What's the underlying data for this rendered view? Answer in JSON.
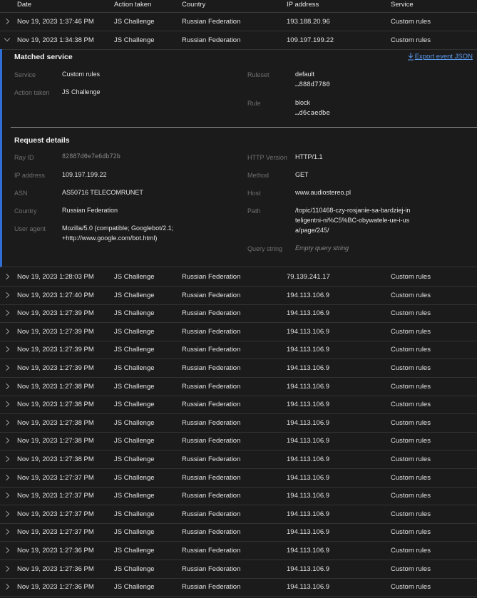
{
  "columns": [
    "Date",
    "Action taken",
    "Country",
    "IP address",
    "Service"
  ],
  "rows_top": [
    {
      "date": "Nov 19, 2023 1:37:46 PM",
      "action": "JS Challenge",
      "country": "Russian Federation",
      "ip": "193.188.20.96",
      "service": "Custom rules"
    },
    {
      "date": "Nov 19, 2023 1:34:38 PM",
      "action": "JS Challenge",
      "country": "Russian Federation",
      "ip": "109.197.199.22",
      "service": "Custom rules"
    }
  ],
  "expanded": {
    "matched_title": "Matched service",
    "export_label": "Export event JSON",
    "service_label": "Service",
    "service_value": "Custom rules",
    "action_label": "Action taken",
    "action_value": "JS Challenge",
    "ruleset_label": "Ruleset",
    "ruleset_name": "default",
    "ruleset_id": "…888d7780",
    "rule_label": "Rule",
    "rule_name": "block",
    "rule_id": "…d6caedbe",
    "request_title": "Request details",
    "rayid_label": "Ray ID",
    "rayid_value": "82887d0e7e6db72b",
    "ip_label": "IP address",
    "ip_value": "109.197.199.22",
    "asn_label": "ASN",
    "asn_value": "AS50716 TELECOMRUNET",
    "country_label": "Country",
    "country_value": "Russian Federation",
    "ua_label": "User agent",
    "ua_line1": "Mozilla/5.0 (compatible; Googlebot/2.1;",
    "ua_line2": "+http://www.google.com/bot.html)",
    "http_label": "HTTP Version",
    "http_value": "HTTP/1.1",
    "method_label": "Method",
    "method_value": "GET",
    "host_label": "Host",
    "host_value": "www.audiostereo.pl",
    "path_label": "Path",
    "path_line1": "/topic/110468-czy-rosjanie-sa-bardziej-in",
    "path_line2": "teligentni-ni%C5%BC-obywatele-ue-i-us",
    "path_line3": "a/page/245/",
    "query_label": "Query string",
    "query_value": "Empty query string"
  },
  "rows_bottom": [
    {
      "date": "Nov 19, 2023 1:28:03 PM",
      "action": "JS Challenge",
      "country": "Russian Federation",
      "ip": "79.139.241.17",
      "service": "Custom rules"
    },
    {
      "date": "Nov 19, 2023 1:27:40 PM",
      "action": "JS Challenge",
      "country": "Russian Federation",
      "ip": "194.113.106.9",
      "service": "Custom rules"
    },
    {
      "date": "Nov 19, 2023 1:27:39 PM",
      "action": "JS Challenge",
      "country": "Russian Federation",
      "ip": "194.113.106.9",
      "service": "Custom rules"
    },
    {
      "date": "Nov 19, 2023 1:27:39 PM",
      "action": "JS Challenge",
      "country": "Russian Federation",
      "ip": "194.113.106.9",
      "service": "Custom rules"
    },
    {
      "date": "Nov 19, 2023 1:27:39 PM",
      "action": "JS Challenge",
      "country": "Russian Federation",
      "ip": "194.113.106.9",
      "service": "Custom rules"
    },
    {
      "date": "Nov 19, 2023 1:27:39 PM",
      "action": "JS Challenge",
      "country": "Russian Federation",
      "ip": "194.113.106.9",
      "service": "Custom rules"
    },
    {
      "date": "Nov 19, 2023 1:27:38 PM",
      "action": "JS Challenge",
      "country": "Russian Federation",
      "ip": "194.113.106.9",
      "service": "Custom rules"
    },
    {
      "date": "Nov 19, 2023 1:27:38 PM",
      "action": "JS Challenge",
      "country": "Russian Federation",
      "ip": "194.113.106.9",
      "service": "Custom rules"
    },
    {
      "date": "Nov 19, 2023 1:27:38 PM",
      "action": "JS Challenge",
      "country": "Russian Federation",
      "ip": "194.113.106.9",
      "service": "Custom rules"
    },
    {
      "date": "Nov 19, 2023 1:27:38 PM",
      "action": "JS Challenge",
      "country": "Russian Federation",
      "ip": "194.113.106.9",
      "service": "Custom rules"
    },
    {
      "date": "Nov 19, 2023 1:27:38 PM",
      "action": "JS Challenge",
      "country": "Russian Federation",
      "ip": "194.113.106.9",
      "service": "Custom rules"
    },
    {
      "date": "Nov 19, 2023 1:27:37 PM",
      "action": "JS Challenge",
      "country": "Russian Federation",
      "ip": "194.113.106.9",
      "service": "Custom rules"
    },
    {
      "date": "Nov 19, 2023 1:27:37 PM",
      "action": "JS Challenge",
      "country": "Russian Federation",
      "ip": "194.113.106.9",
      "service": "Custom rules"
    },
    {
      "date": "Nov 19, 2023 1:27:37 PM",
      "action": "JS Challenge",
      "country": "Russian Federation",
      "ip": "194.113.106.9",
      "service": "Custom rules"
    },
    {
      "date": "Nov 19, 2023 1:27:37 PM",
      "action": "JS Challenge",
      "country": "Russian Federation",
      "ip": "194.113.106.9",
      "service": "Custom rules"
    },
    {
      "date": "Nov 19, 2023 1:27:36 PM",
      "action": "JS Challenge",
      "country": "Russian Federation",
      "ip": "194.113.106.9",
      "service": "Custom rules"
    },
    {
      "date": "Nov 19, 2023 1:27:36 PM",
      "action": "JS Challenge",
      "country": "Russian Federation",
      "ip": "194.113.106.9",
      "service": "Custom rules"
    },
    {
      "date": "Nov 19, 2023 1:27:36 PM",
      "action": "JS Challenge",
      "country": "Russian Federation",
      "ip": "194.113.106.9",
      "service": "Custom rules"
    }
  ]
}
